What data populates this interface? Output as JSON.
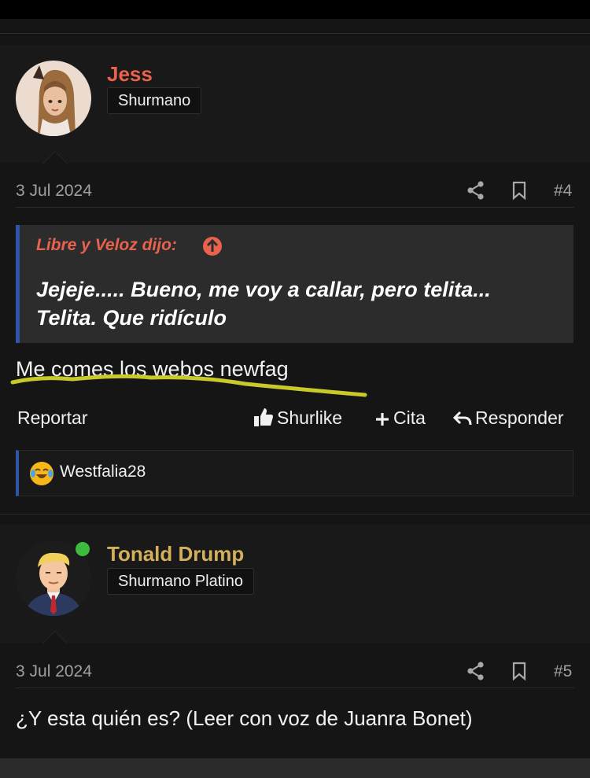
{
  "posts": [
    {
      "username": "Jess",
      "username_color": "#e8624d",
      "user_title": "Shurmano",
      "avatar_icon": "user-avatar-jess",
      "date": "3 Jul 2024",
      "post_number": "#4",
      "share_icon": "share-icon",
      "bookmark_icon": "bookmark-icon",
      "quote": {
        "author": "Libre y Veloz dijo:",
        "jump_icon": "arrow-up-circle-icon",
        "text": "Jejeje..... Bueno, me voy a callar, pero telita... Telita. Que ridículo"
      },
      "body": "Me comes los webos newfag",
      "annotation": "yellow-underline-highlight",
      "actions": {
        "report": "Reportar",
        "like": "Shurlike",
        "quote": "Cita",
        "reply": "Responder"
      },
      "reactions": [
        {
          "emoji": "laughing-tears-emoji",
          "user": "Westfalia28"
        }
      ]
    },
    {
      "username": "Tonald Drump",
      "username_color": "#d4b05a",
      "user_title": "Shurmano Platino",
      "avatar_icon": "user-avatar-tonald-drump",
      "online_status": "online",
      "date": "3 Jul 2024",
      "post_number": "#5",
      "share_icon": "share-icon",
      "bookmark_icon": "bookmark-icon",
      "body": "¿Y esta quién es? (Leer con voz de Juanra Bonet)"
    }
  ],
  "colors": {
    "background": "#151515",
    "header_background": "#191919",
    "quote_background": "#2c2c2c",
    "accent_blue": "#2f55a8",
    "meta_gray": "#a0a0a0",
    "highlight_yellow": "#c9c92a"
  }
}
